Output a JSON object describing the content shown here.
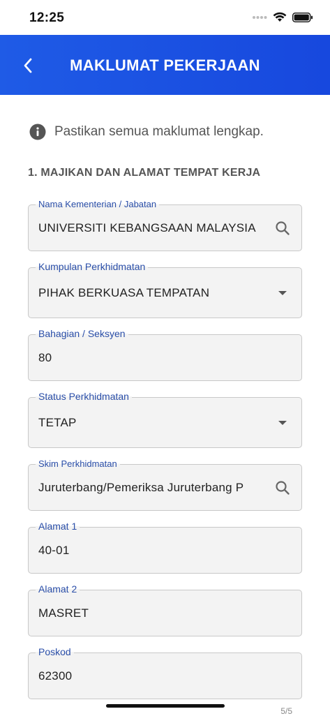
{
  "status_bar": {
    "time": "12:25"
  },
  "header": {
    "title": "MAKLUMAT PEKERJAAN"
  },
  "info": {
    "text": "Pastikan semua maklumat lengkap."
  },
  "section": {
    "title": "1. MAJIKAN DAN ALAMAT TEMPAT KERJA"
  },
  "fields": {
    "kementerian": {
      "label": "Nama Kementerian / Jabatan",
      "value": "UNIVERSITI KEBANGSAAN MALAYSIA",
      "icon": "search-icon"
    },
    "kumpulan": {
      "label": "Kumpulan Perkhidmatan",
      "value": "PIHAK BERKUASA TEMPATAN",
      "icon": "dropdown-arrow-icon"
    },
    "bahagian": {
      "label": "Bahagian / Seksyen",
      "value": "80"
    },
    "status": {
      "label": "Status Perkhidmatan",
      "value": "TETAP",
      "icon": "dropdown-arrow-icon"
    },
    "skim": {
      "label": "Skim Perkhidmatan",
      "value": "Juruterbang/Pemeriksa Juruterbang P",
      "icon": "search-icon"
    },
    "alamat1": {
      "label": "Alamat 1",
      "value": "40-01"
    },
    "alamat2": {
      "label": "Alamat 2",
      "value": "MASRET"
    },
    "poskod": {
      "label": "Poskod",
      "value": "62300"
    }
  },
  "pagination": {
    "text": "5/5"
  },
  "colors": {
    "primary": "#1f5be6",
    "label": "#2a4ea8",
    "field_bg": "#f3f3f3"
  }
}
